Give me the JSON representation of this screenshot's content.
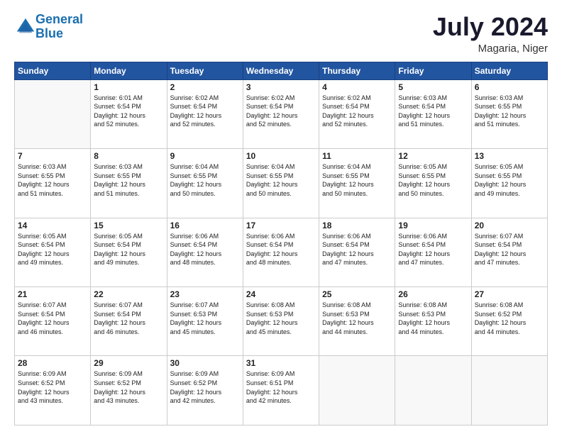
{
  "header": {
    "logo_line1": "General",
    "logo_line2": "Blue",
    "month_year": "July 2024",
    "location": "Magaria, Niger"
  },
  "days_of_week": [
    "Sunday",
    "Monday",
    "Tuesday",
    "Wednesday",
    "Thursday",
    "Friday",
    "Saturday"
  ],
  "weeks": [
    [
      {
        "day": "",
        "info": ""
      },
      {
        "day": "1",
        "info": "Sunrise: 6:01 AM\nSunset: 6:54 PM\nDaylight: 12 hours\nand 52 minutes."
      },
      {
        "day": "2",
        "info": "Sunrise: 6:02 AM\nSunset: 6:54 PM\nDaylight: 12 hours\nand 52 minutes."
      },
      {
        "day": "3",
        "info": "Sunrise: 6:02 AM\nSunset: 6:54 PM\nDaylight: 12 hours\nand 52 minutes."
      },
      {
        "day": "4",
        "info": "Sunrise: 6:02 AM\nSunset: 6:54 PM\nDaylight: 12 hours\nand 52 minutes."
      },
      {
        "day": "5",
        "info": "Sunrise: 6:03 AM\nSunset: 6:54 PM\nDaylight: 12 hours\nand 51 minutes."
      },
      {
        "day": "6",
        "info": "Sunrise: 6:03 AM\nSunset: 6:55 PM\nDaylight: 12 hours\nand 51 minutes."
      }
    ],
    [
      {
        "day": "7",
        "info": "Sunrise: 6:03 AM\nSunset: 6:55 PM\nDaylight: 12 hours\nand 51 minutes."
      },
      {
        "day": "8",
        "info": "Sunrise: 6:03 AM\nSunset: 6:55 PM\nDaylight: 12 hours\nand 51 minutes."
      },
      {
        "day": "9",
        "info": "Sunrise: 6:04 AM\nSunset: 6:55 PM\nDaylight: 12 hours\nand 50 minutes."
      },
      {
        "day": "10",
        "info": "Sunrise: 6:04 AM\nSunset: 6:55 PM\nDaylight: 12 hours\nand 50 minutes."
      },
      {
        "day": "11",
        "info": "Sunrise: 6:04 AM\nSunset: 6:55 PM\nDaylight: 12 hours\nand 50 minutes."
      },
      {
        "day": "12",
        "info": "Sunrise: 6:05 AM\nSunset: 6:55 PM\nDaylight: 12 hours\nand 50 minutes."
      },
      {
        "day": "13",
        "info": "Sunrise: 6:05 AM\nSunset: 6:55 PM\nDaylight: 12 hours\nand 49 minutes."
      }
    ],
    [
      {
        "day": "14",
        "info": "Sunrise: 6:05 AM\nSunset: 6:54 PM\nDaylight: 12 hours\nand 49 minutes."
      },
      {
        "day": "15",
        "info": "Sunrise: 6:05 AM\nSunset: 6:54 PM\nDaylight: 12 hours\nand 49 minutes."
      },
      {
        "day": "16",
        "info": "Sunrise: 6:06 AM\nSunset: 6:54 PM\nDaylight: 12 hours\nand 48 minutes."
      },
      {
        "day": "17",
        "info": "Sunrise: 6:06 AM\nSunset: 6:54 PM\nDaylight: 12 hours\nand 48 minutes."
      },
      {
        "day": "18",
        "info": "Sunrise: 6:06 AM\nSunset: 6:54 PM\nDaylight: 12 hours\nand 47 minutes."
      },
      {
        "day": "19",
        "info": "Sunrise: 6:06 AM\nSunset: 6:54 PM\nDaylight: 12 hours\nand 47 minutes."
      },
      {
        "day": "20",
        "info": "Sunrise: 6:07 AM\nSunset: 6:54 PM\nDaylight: 12 hours\nand 47 minutes."
      }
    ],
    [
      {
        "day": "21",
        "info": "Sunrise: 6:07 AM\nSunset: 6:54 PM\nDaylight: 12 hours\nand 46 minutes."
      },
      {
        "day": "22",
        "info": "Sunrise: 6:07 AM\nSunset: 6:54 PM\nDaylight: 12 hours\nand 46 minutes."
      },
      {
        "day": "23",
        "info": "Sunrise: 6:07 AM\nSunset: 6:53 PM\nDaylight: 12 hours\nand 45 minutes."
      },
      {
        "day": "24",
        "info": "Sunrise: 6:08 AM\nSunset: 6:53 PM\nDaylight: 12 hours\nand 45 minutes."
      },
      {
        "day": "25",
        "info": "Sunrise: 6:08 AM\nSunset: 6:53 PM\nDaylight: 12 hours\nand 44 minutes."
      },
      {
        "day": "26",
        "info": "Sunrise: 6:08 AM\nSunset: 6:53 PM\nDaylight: 12 hours\nand 44 minutes."
      },
      {
        "day": "27",
        "info": "Sunrise: 6:08 AM\nSunset: 6:52 PM\nDaylight: 12 hours\nand 44 minutes."
      }
    ],
    [
      {
        "day": "28",
        "info": "Sunrise: 6:09 AM\nSunset: 6:52 PM\nDaylight: 12 hours\nand 43 minutes."
      },
      {
        "day": "29",
        "info": "Sunrise: 6:09 AM\nSunset: 6:52 PM\nDaylight: 12 hours\nand 43 minutes."
      },
      {
        "day": "30",
        "info": "Sunrise: 6:09 AM\nSunset: 6:52 PM\nDaylight: 12 hours\nand 42 minutes."
      },
      {
        "day": "31",
        "info": "Sunrise: 6:09 AM\nSunset: 6:51 PM\nDaylight: 12 hours\nand 42 minutes."
      },
      {
        "day": "",
        "info": ""
      },
      {
        "day": "",
        "info": ""
      },
      {
        "day": "",
        "info": ""
      }
    ]
  ]
}
